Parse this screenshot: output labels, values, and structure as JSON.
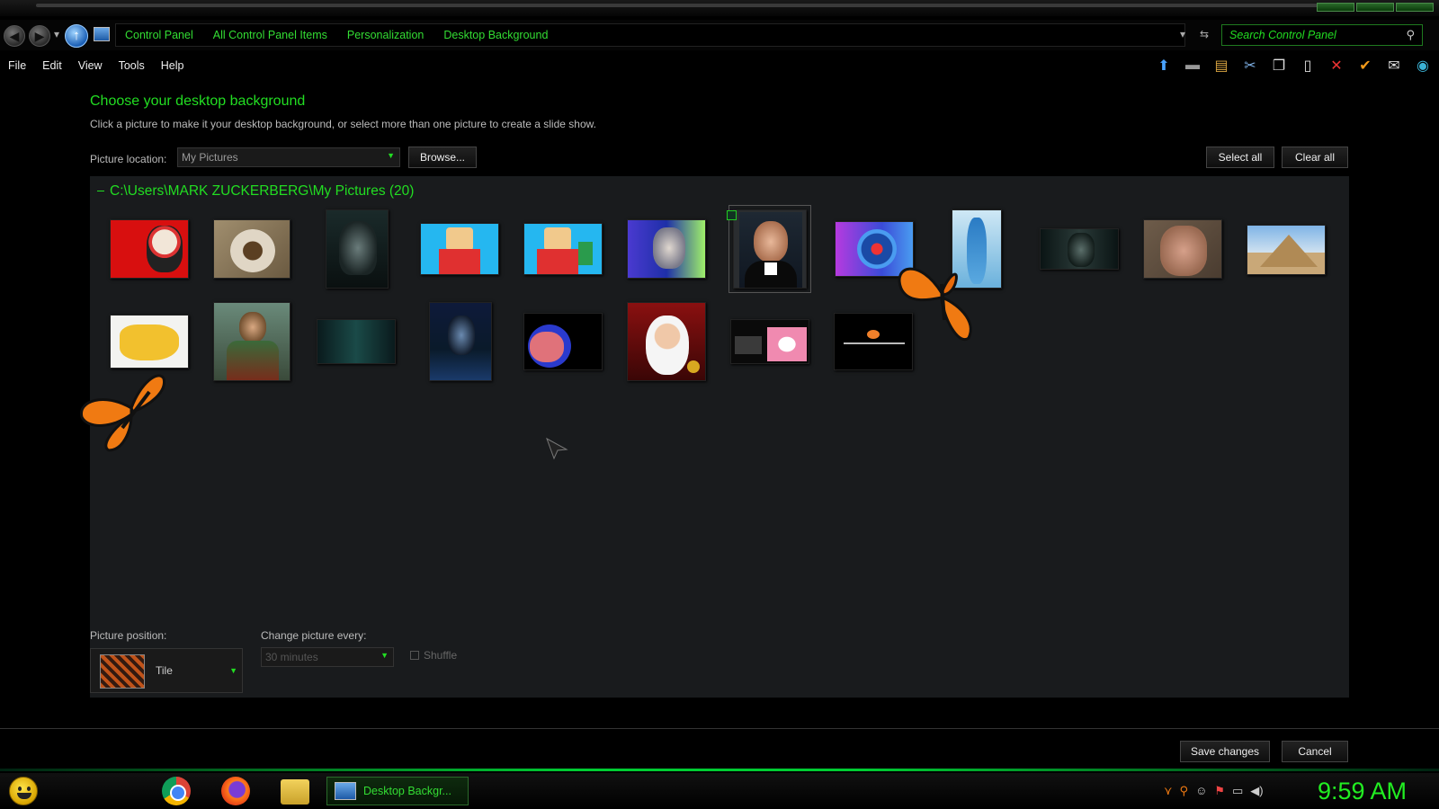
{
  "window": {
    "breadcrumbs": [
      "Control Panel",
      "All Control Panel Items",
      "Personalization",
      "Desktop Background"
    ],
    "search_placeholder": "Search Control Panel"
  },
  "menu": [
    "File",
    "Edit",
    "View",
    "Tools",
    "Help"
  ],
  "toolbar_icons": [
    "up-arrow-icon",
    "drive-icon",
    "properties-icon",
    "cut-icon",
    "copy-icon",
    "paste-icon",
    "delete-icon",
    "checkmark-icon",
    "envelope-icon",
    "globe-icon"
  ],
  "page": {
    "heading": "Choose your desktop background",
    "subtext": "Click a picture to make it your desktop background, or select more than one picture to create a slide show.",
    "location_label": "Picture location:",
    "location_value": "My Pictures",
    "browse_label": "Browse...",
    "select_all_label": "Select all",
    "clear_all_label": "Clear all",
    "group_title": "C:\\Users\\MARK ZUCKERBERG\\My Pictures (20)"
  },
  "pictures": [
    {
      "name": "red-flag-cartoon-image"
    },
    {
      "name": "toilet-image"
    },
    {
      "name": "morbius-poster-image"
    },
    {
      "name": "cartoon-man-image"
    },
    {
      "name": "cartoon-man-with-doll-image"
    },
    {
      "name": "old-man-image"
    },
    {
      "name": "mark-zuckerberg-image",
      "selected": true
    },
    {
      "name": "blue-circle-logo-image"
    },
    {
      "name": "blue-figure-image"
    },
    {
      "name": "dark-face-image"
    },
    {
      "name": "hand-image"
    },
    {
      "name": "pyramid-image"
    },
    {
      "name": "us-map-image"
    },
    {
      "name": "painting-man-image"
    },
    {
      "name": "dark-teal-scene-image"
    },
    {
      "name": "morbius-poster-2-image"
    },
    {
      "name": "pink-cartoon-image"
    },
    {
      "name": "santa-claus-image"
    },
    {
      "name": "meme-collage-image"
    },
    {
      "name": "black-text-image"
    }
  ],
  "options": {
    "position_label": "Picture position:",
    "position_value": "Tile",
    "change_label": "Change picture every:",
    "change_value": "30 minutes",
    "shuffle_label": "Shuffle"
  },
  "footer": {
    "save_label": "Save changes",
    "cancel_label": "Cancel"
  },
  "taskbar": {
    "active_task": "Desktop Backgr...",
    "clock": "9:59 AM"
  }
}
